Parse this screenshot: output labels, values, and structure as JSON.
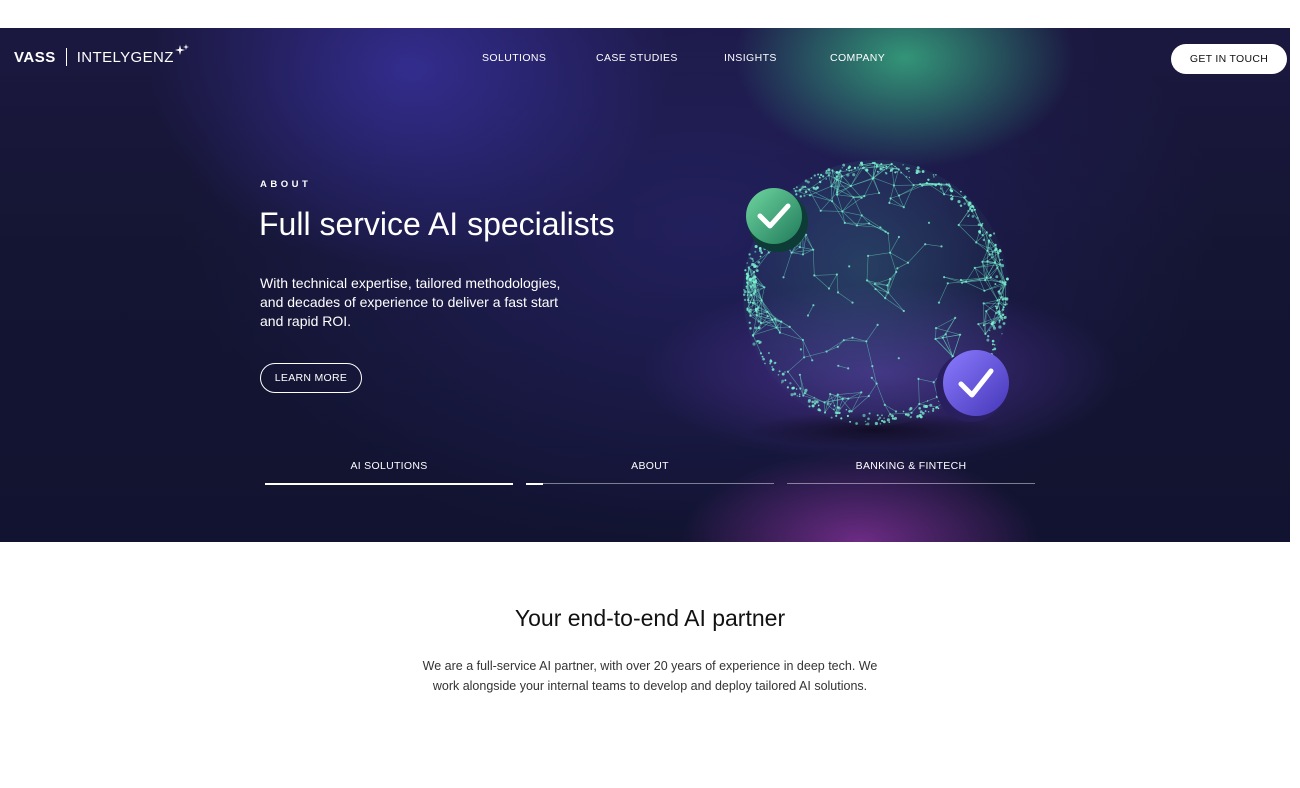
{
  "brand": {
    "name": "VASS",
    "product": "INTELYGENZ"
  },
  "nav": {
    "items": [
      {
        "label": "SOLUTIONS"
      },
      {
        "label": "CASE STUDIES"
      },
      {
        "label": "INSIGHTS"
      },
      {
        "label": "COMPANY"
      }
    ],
    "cta": "GET IN TOUCH"
  },
  "hero": {
    "eyebrow": "ABOUT",
    "title": "Full service AI specialists",
    "description": "With technical expertise, tailored methodologies, and decades of experience to deliver a fast start and rapid ROI.",
    "button": "LEARN MORE"
  },
  "tabs": [
    {
      "label": "AI SOLUTIONS",
      "progress": 1.0
    },
    {
      "label": "ABOUT",
      "progress": 0.07
    },
    {
      "label": "BANKING & FINTECH",
      "progress": 0
    }
  ],
  "section": {
    "heading": "Your end-to-end AI partner",
    "body": "We are a full-service AI partner, with over 20 years of experience in deep tech. We work alongside your internal teams to develop and deploy tailored AI solutions."
  },
  "colors": {
    "hero_bg": "#141532",
    "accent_green": "#3abe87",
    "accent_purple": "#6b5cf0",
    "globe": "#5ee0bf"
  },
  "icons": [
    "sparkle-icon",
    "checkmark-icon"
  ]
}
